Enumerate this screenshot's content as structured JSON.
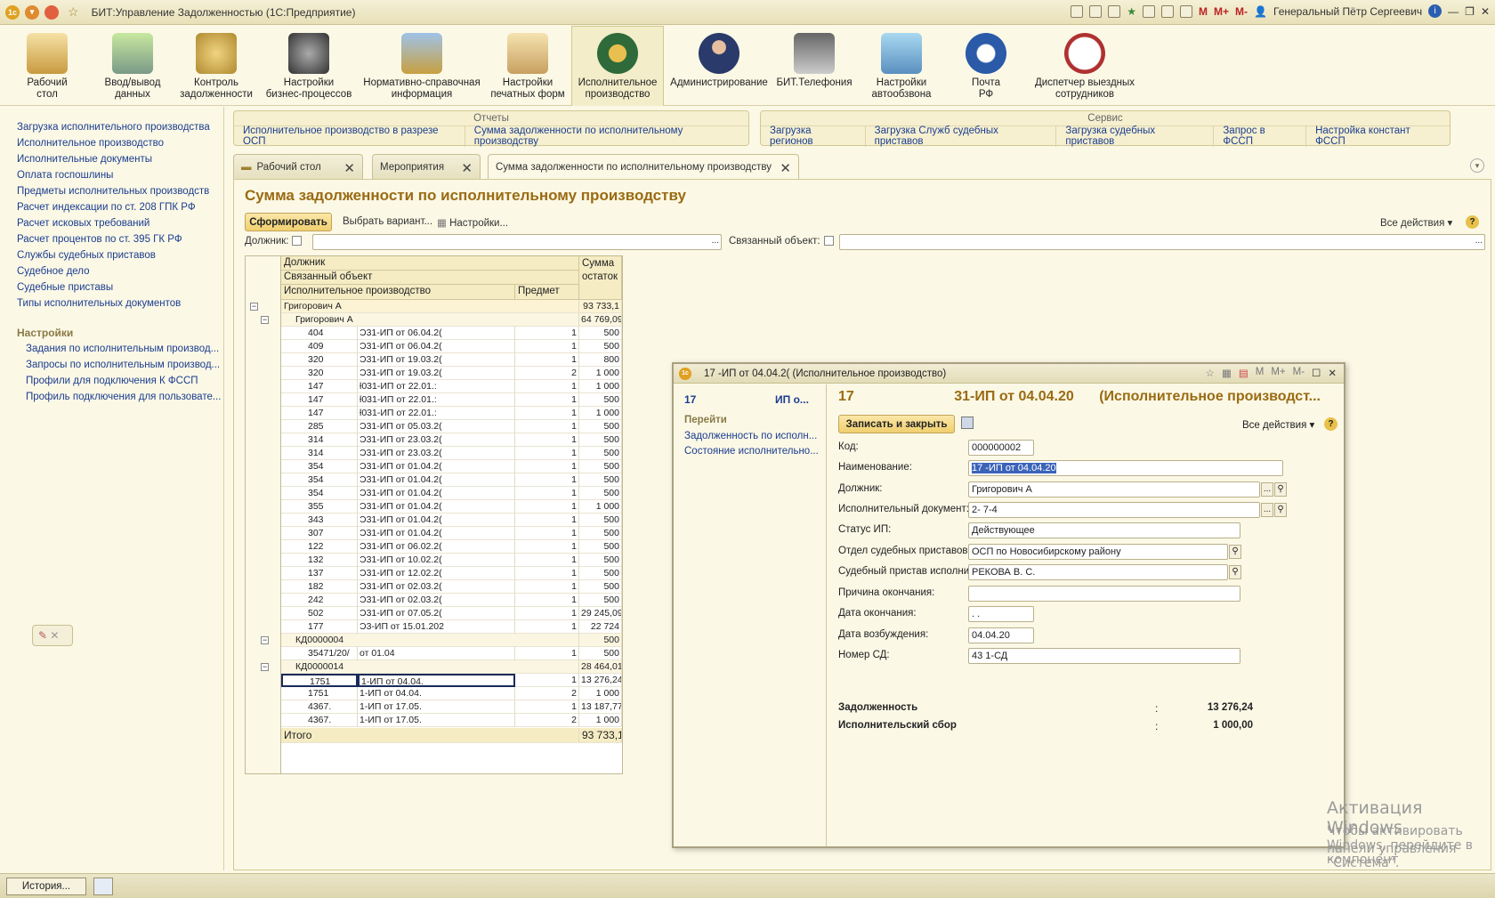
{
  "window": {
    "title": "БИТ:Управление Задолженностью  (1С:Предприятие)",
    "user": "Генеральный Пётр Сергеевич",
    "m": "M",
    "mplus": "M+",
    "mminus": "M-"
  },
  "sections": [
    {
      "l1": "Рабочий",
      "l2": "стол",
      "icon": "desktop-icon"
    },
    {
      "l1": "Ввод/вывод",
      "l2": "данных",
      "icon": "import-export-icon"
    },
    {
      "l1": "Контроль",
      "l2": "задолженности",
      "icon": "coins-icon"
    },
    {
      "l1": "Настройки",
      "l2": "бизнес-процессов",
      "icon": "gears-icon"
    },
    {
      "l1": "Нормативно-справочная",
      "l2": "информация",
      "icon": "cabinet-icon"
    },
    {
      "l1": "Настройки",
      "l2": "печатных форм",
      "icon": "printforms-icon"
    },
    {
      "l1": "Исполнительное",
      "l2": "производство",
      "icon": "emblem-icon"
    },
    {
      "l1": "Администрирование",
      "l2": "",
      "icon": "admin-icon"
    },
    {
      "l1": "БИТ.Телефония",
      "l2": "",
      "icon": "phone-icon"
    },
    {
      "l1": "Настройки",
      "l2": "автообзвона",
      "icon": "autodial-icon"
    },
    {
      "l1": "Почта",
      "l2": "РФ",
      "icon": "post-icon"
    },
    {
      "l1": "Диспетчер выездных",
      "l2": "сотрудников",
      "icon": "dispatcher-icon"
    }
  ],
  "left_nav": [
    "Загрузка исполнительного производства",
    "Исполнительное производство",
    "Исполнительные документы",
    "Оплата госпошлины",
    "Предметы исполнительных производств",
    "Расчет индексации по ст. 208 ГПК РФ",
    "Расчет исковых требований",
    "Расчет процентов по ст. 395 ГК РФ",
    "Службы судебных приставов",
    "Судебное дело",
    "Судебные приставы",
    "Типы исполнительных документов"
  ],
  "settings": {
    "title": "Настройки",
    "items": [
      "Задания по исполнительным производ...",
      "Запросы по исполнительным производ...",
      "Профили для подключения К ФССП",
      "Профиль подключения для пользовате..."
    ]
  },
  "reports": {
    "title": "Отчеты",
    "links": [
      "Исполнительное производство в разрезе ОСП",
      "Сумма задолженности по исполнительному производству"
    ]
  },
  "service": {
    "title": "Сервис",
    "links": [
      "Загрузка регионов",
      "Загрузка Служб судебных приставов",
      "Загрузка судебных приставов",
      "Запрос в ФССП",
      "Настройка констант ФССП"
    ]
  },
  "tabs": [
    "Рабочий стол",
    "Мероприятия",
    "Сумма задолженности по исполнительному производству"
  ],
  "report": {
    "title": "Сумма задолженности по исполнительному производству",
    "generate": "Сформировать",
    "variant": "Выбрать вариант...",
    "settings": "Настройки...",
    "all_actions": "Все действия ▾",
    "debtor_label": "Должник:",
    "related_label": "Связанный объект:",
    "ellipsis": "...",
    "headers": {
      "debtor": "Должник",
      "related": "Связанный объект",
      "ip": "Исполнительное производство",
      "subject": "Предмет",
      "sum1": "Сумма",
      "sum2": "остаток"
    },
    "groups": [
      {
        "name": "Григорович А",
        "sum": "93 733,1"
      },
      {
        "name": "Григорович А",
        "sum": "64 769,09"
      }
    ],
    "rows": [
      [
        "404",
        "Ɔ31-ИП от 06.04.2(",
        "1",
        "500"
      ],
      [
        "409",
        "Ɔ31-ИП от 06.04.2(",
        "1",
        "500"
      ],
      [
        "320",
        "Ɔ31-ИП от 19.03.2(",
        "1",
        "800"
      ],
      [
        "320",
        "Ɔ31-ИП от 19.03.2(",
        "2",
        "1 000"
      ],
      [
        "147",
        "ƚ031-ИП от 22.01.:",
        "1",
        "1 000"
      ],
      [
        "147",
        "ƚ031-ИП от 22.01.:",
        "1",
        "500"
      ],
      [
        "147",
        "ƚ031-ИП от 22.01.:",
        "1",
        "1 000"
      ],
      [
        "285",
        "Ɔ31-ИП от 05.03.2(",
        "1",
        "500"
      ],
      [
        "314",
        "Ɔ31-ИП от 23.03.2(",
        "1",
        "500"
      ],
      [
        "314",
        "Ɔ31-ИП от 23.03.2(",
        "1",
        "500"
      ],
      [
        "354",
        "Ɔ31-ИП от 01.04.2(",
        "1",
        "500"
      ],
      [
        "354",
        "Ɔ31-ИП от 01.04.2(",
        "1",
        "500"
      ],
      [
        "354",
        "Ɔ31-ИП от 01.04.2(",
        "1",
        "500"
      ],
      [
        "355",
        "Ɔ31-ИП от 01.04.2(",
        "1",
        "1 000"
      ],
      [
        "343",
        "Ɔ31-ИП от 01.04.2(",
        "1",
        "500"
      ],
      [
        "307",
        "Ɔ31-ИП от 01.04.2(",
        "1",
        "500"
      ],
      [
        "122",
        "Ɔ31-ИП от 06.02.2(",
        "1",
        "500"
      ],
      [
        "132",
        "Ɔ31-ИП от 10.02.2(",
        "1",
        "500"
      ],
      [
        "137",
        "Ɔ31-ИП от 12.02.2(",
        "1",
        "500"
      ],
      [
        "182",
        "Ɔ31-ИП от 02.03.2(",
        "1",
        "500"
      ],
      [
        "242",
        "Ɔ31-ИП от 02.03.2(",
        "1",
        "500"
      ],
      [
        "502",
        "Ɔ31-ИП от 07.05.2(",
        "1",
        "29 245,09"
      ],
      [
        "177",
        "Ɔ3-ИП от 15.01.202",
        "1",
        "22 724"
      ]
    ],
    "kd1": {
      "name": "КД0000004",
      "sum": "500",
      "row": [
        "35471/20/",
        "от 01.04",
        "1",
        "500"
      ]
    },
    "kd2": {
      "name": "КД0000014",
      "sum": "28 464,01",
      "rows": [
        [
          "1751",
          "1-ИП от 04.04.",
          "1",
          "13 276,24"
        ],
        [
          "1751",
          "1-ИП от 04.04.",
          "2",
          "1 000"
        ],
        [
          "4367.",
          "1-ИП от 17.05.",
          "1",
          "13 187,77"
        ],
        [
          "4367.",
          "1-ИП от 17.05.",
          "2",
          "1 000"
        ]
      ]
    },
    "total": {
      "label": "Итого",
      "sum": "93 733,1"
    }
  },
  "dialog": {
    "titlebar": "17              -ИП от 04.04.2(    (Исполнительное производство)",
    "nav_num": "17",
    "nav_ip": "ИП о...",
    "goto": "Перейти",
    "links": [
      "Задолженность по исполн...",
      "Состояние исполнительно..."
    ],
    "heading_num": "17",
    "heading_ip": "31-ИП от 04.04.20",
    "heading_type": "(Исполнительное производст...",
    "save": "Записать и закрыть",
    "all_actions": "Все действия ▾",
    "fields": [
      {
        "label": "Код:",
        "value": "000000002"
      },
      {
        "label": "Наименование:",
        "value": "17                  -ИП от 04.04.20"
      },
      {
        "label": "Должник:",
        "value": "Григорович А"
      },
      {
        "label": "Исполнительный документ:",
        "value": "2-             7-4"
      },
      {
        "label": "Статус ИП:",
        "value": "Действующее"
      },
      {
        "label": "Отдел судебных приставов:",
        "value": "ОСП по Новосибирскому району"
      },
      {
        "label": "Судебный пристав исполнитель:",
        "value": "РЕКОВА В. С."
      },
      {
        "label": "Причина окончания:",
        "value": ""
      },
      {
        "label": "Дата окончания:",
        "value": "  .  ."
      },
      {
        "label": "Дата возбуждения:",
        "value": "04.04.20"
      },
      {
        "label": "Номер СД:",
        "value": "43                  1-СД"
      }
    ],
    "debt_label": "Задолженность",
    "debt_value": "13 276,24",
    "fee_label": "Исполнительский сбор",
    "fee_value": "1 000,00",
    "colon": ":"
  },
  "watermark": {
    "line1": "Активация Windows",
    "line2": "Чтобы активировать Windows, перейдите в компонент",
    "line3": "панели управления “Система”."
  },
  "statusbar": {
    "history": "История..."
  }
}
